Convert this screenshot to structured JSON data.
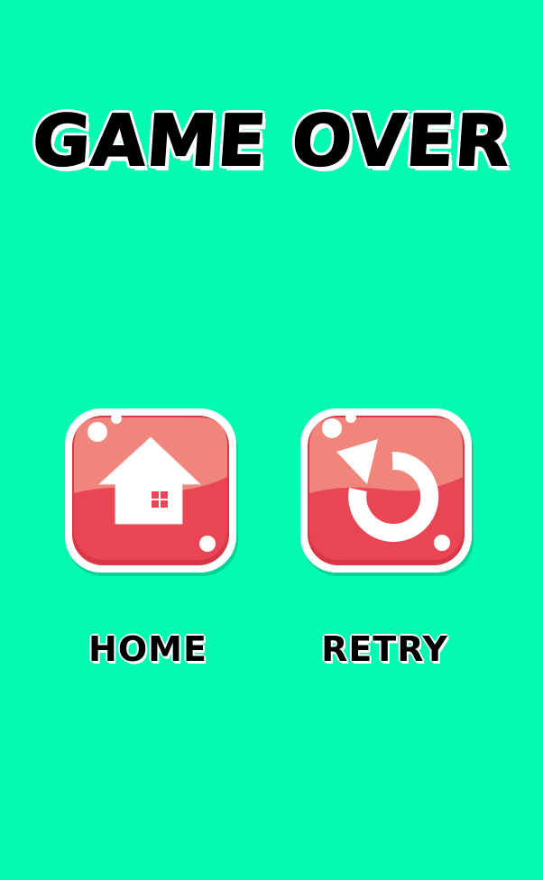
{
  "title": "GAME OVER",
  "buttons": {
    "home": {
      "label": "HOME",
      "icon": "home-icon"
    },
    "retry": {
      "label": "RETRY",
      "icon": "retry-icon"
    }
  },
  "colors": {
    "background": "#02fbb0",
    "button_red": "#e94555",
    "button_light": "#f0857b",
    "button_border": "#ffffff",
    "text": "#000000"
  }
}
